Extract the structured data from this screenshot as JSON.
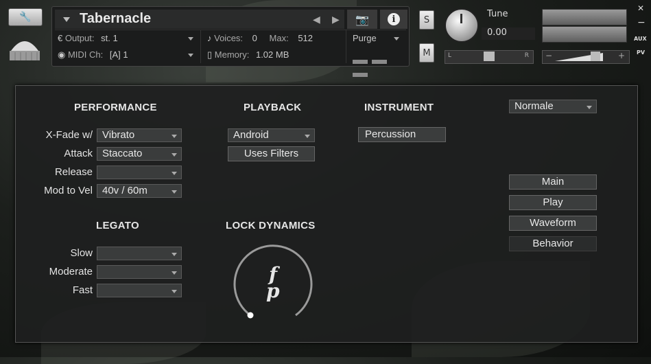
{
  "header": {
    "instrument_name": "Tabernacle",
    "output_label": "Output:",
    "output_value": "st. 1",
    "voices_label": "Voices:",
    "voices_value": "0",
    "max_label": "Max:",
    "max_value": "512",
    "midi_label": "MIDI Ch:",
    "midi_value": "[A]  1",
    "memory_label": "Memory:",
    "memory_value": "1.02 MB",
    "purge_label": "Purge",
    "solo_label": "S",
    "mute_label": "M",
    "tune_label": "Tune",
    "tune_value": "0.00",
    "pan_left": "L",
    "pan_right": "R",
    "vol_minus": "−",
    "vol_plus": "+",
    "aux_label": "AUX",
    "pv_label": "PV",
    "minimize": "−"
  },
  "performance": {
    "heading": "PERFORMANCE",
    "rows": [
      {
        "label": "X-Fade w/",
        "value": "Vibrato"
      },
      {
        "label": "Attack",
        "value": "Staccato"
      },
      {
        "label": "Release",
        "value": ""
      },
      {
        "label": "Mod to Vel",
        "value": "40v / 60m"
      }
    ]
  },
  "legato": {
    "heading": "LEGATO",
    "rows": [
      {
        "label": "Slow",
        "value": ""
      },
      {
        "label": "Moderate",
        "value": ""
      },
      {
        "label": "Fast",
        "value": ""
      }
    ]
  },
  "playback": {
    "heading": "PLAYBACK",
    "mode": "Android",
    "filters_button": "Uses Filters"
  },
  "lock_dynamics": {
    "heading": "LOCK DYNAMICS",
    "dial_glyph_top": "f",
    "dial_glyph_bottom": "p"
  },
  "instrument": {
    "heading": "INSTRUMENT",
    "button": "Percussion"
  },
  "view": {
    "mode": "Normale",
    "pages": [
      "Main",
      "Play",
      "Waveform",
      "Behavior"
    ],
    "active_page": "Behavior"
  }
}
